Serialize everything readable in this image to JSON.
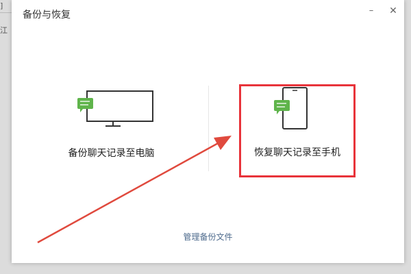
{
  "background": {
    "fragment_top": "]",
    "fragment_mid": "江"
  },
  "dialog": {
    "title": "备份与恢复",
    "minimize_label": "–",
    "close_label": "✕"
  },
  "options": {
    "backup_to_pc": {
      "label": "备份聊天记录至电脑",
      "icon": "monitor-chat-icon"
    },
    "restore_to_phone": {
      "label": "恢复聊天记录至手机",
      "icon": "phone-chat-icon"
    }
  },
  "manage_link": "管理备份文件",
  "colors": {
    "accent_green": "#5fb44b",
    "highlight_red": "#e8333a",
    "link": "#4d6a8c"
  }
}
